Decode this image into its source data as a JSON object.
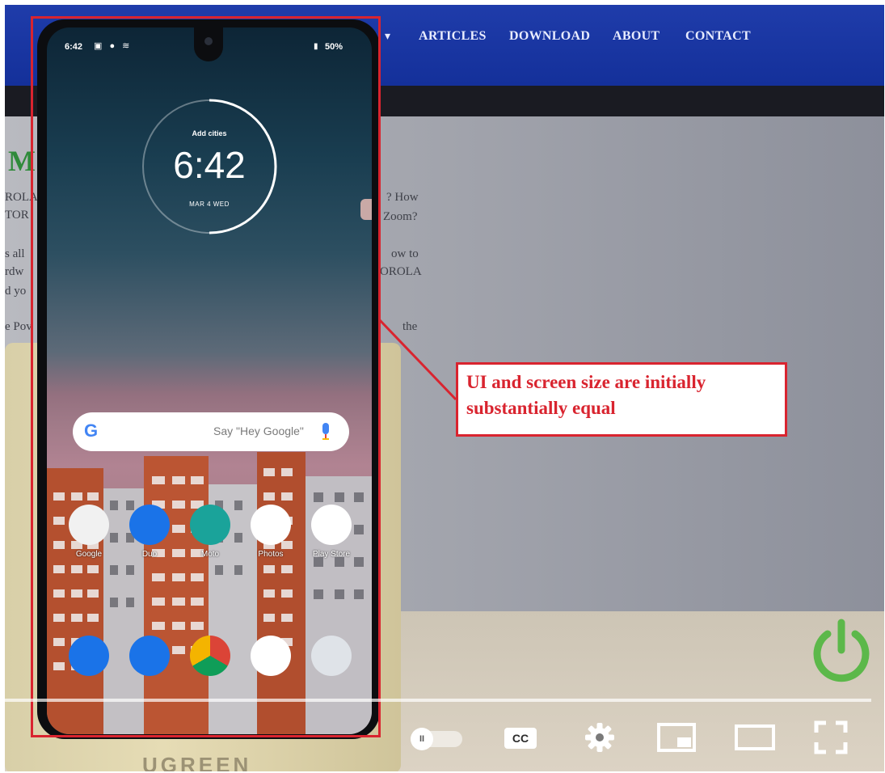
{
  "website": {
    "nav_caret": "▾",
    "nav_links": [
      "ARTICLES",
      "DOWNLOAD",
      "ABOUT",
      "CONTACT"
    ],
    "heading_fragment": "M",
    "text_left": [
      "ROLA",
      "TOR",
      "s all",
      "rdw",
      "d yo",
      "e Pov"
    ],
    "text_right": [
      "? How",
      "Zoom?",
      "ow to",
      "OROLA",
      "the"
    ],
    "stand_brand": "UGREEN"
  },
  "phone": {
    "status": {
      "time": "6:42",
      "icons": "▣ ● ≋",
      "battery": "50%"
    },
    "clock": {
      "cities_label": "Add cities",
      "time": "6:42",
      "date": "MAR 4 WED"
    },
    "search": {
      "logo": "G",
      "hint": "Say \"Hey Google\""
    },
    "apps_row1": [
      {
        "label": "Google",
        "icon": "google-folder-icon",
        "color": "#f1f1f1"
      },
      {
        "label": "Duo",
        "icon": "duo-icon",
        "color": "#1a73e8"
      },
      {
        "label": "Moto",
        "icon": "moto-icon",
        "color": "#1aa39a"
      },
      {
        "label": "Photos",
        "icon": "photos-icon",
        "color": "#ffffff"
      },
      {
        "label": "Play Store",
        "icon": "play-store-icon",
        "color": "#ffffff"
      }
    ],
    "apps_row2": [
      {
        "icon": "phone-icon",
        "color": "#1a73e8"
      },
      {
        "icon": "messages-icon",
        "color": "#1a73e8"
      },
      {
        "icon": "chrome-icon",
        "color": "#ffffff"
      },
      {
        "icon": "google-icon",
        "color": "#ffffff"
      },
      {
        "icon": "camera-icon",
        "color": "#dfe3e8"
      }
    ]
  },
  "annotation": {
    "line1": "UI and screen size are initially",
    "line2": "substantially equal",
    "color": "#d9242f"
  },
  "player": {
    "cc_label": "CC",
    "autoplay_glyph": "II",
    "power_color": "#5cb84a"
  }
}
